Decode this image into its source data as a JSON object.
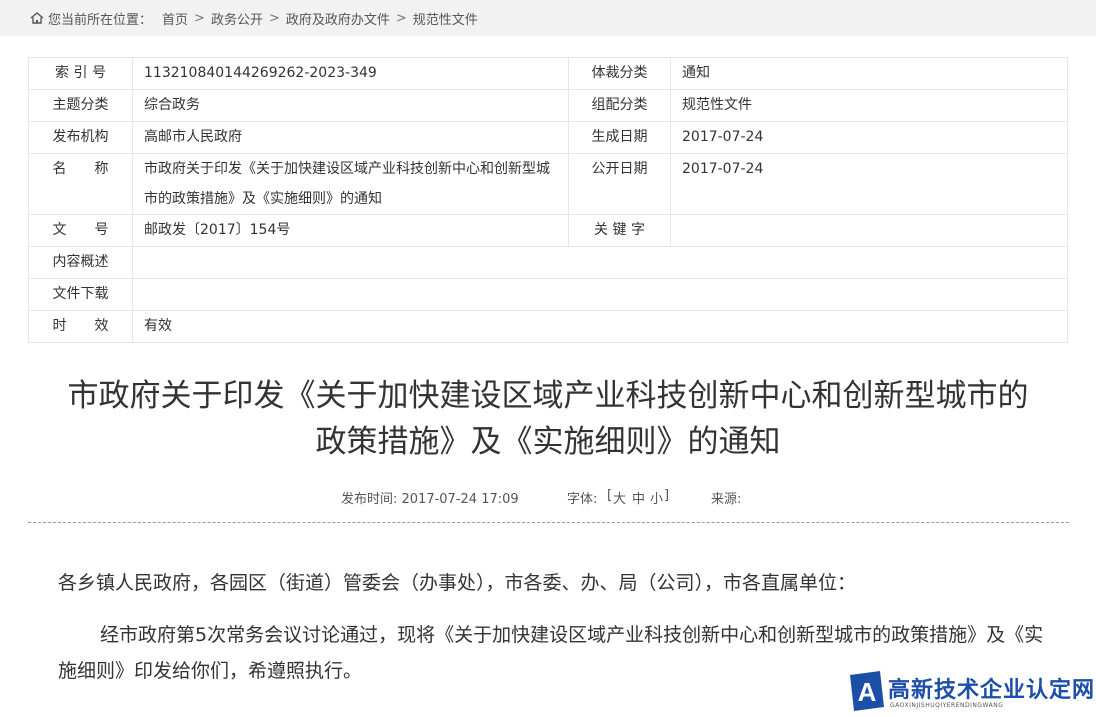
{
  "breadcrumb": {
    "label": "您当前所在位置：",
    "items": [
      "首页",
      "政务公开",
      "政府及政府办文件",
      "规范性文件"
    ],
    "separator": ">"
  },
  "info": {
    "index_label": "索 引 号",
    "index_value": "113210840144269262-2023-349",
    "genre_label": "体裁分类",
    "genre_value": "通知",
    "topic_label": "主题分类",
    "topic_value": "综合政务",
    "category_label": "组配分类",
    "category_value": "规范性文件",
    "publisher_label": "发布机构",
    "publisher_value": "高邮市人民政府",
    "created_label": "生成日期",
    "created_value": "2017-07-24",
    "name_label": "名　　称",
    "name_value": "市政府关于印发《关于加快建设区域产业科技创新中心和创新型城市的政策措施》及《实施细则》的通知",
    "public_label": "公开日期",
    "public_value": "2017-07-24",
    "docno_label": "文　　号",
    "docno_value": "邮政发〔2017〕154号",
    "keyword_label": "关 键 字",
    "keyword_value": "",
    "summary_label": "内容概述",
    "summary_value": "",
    "download_label": "文件下载",
    "download_value": "",
    "validity_label": "时　　效",
    "validity_value": "有效"
  },
  "title": "市政府关于印发《关于加快建设区域产业科技创新中心和创新型城市的政策措施》及《实施细则》的通知",
  "meta": {
    "publish_time": "发布时间: 2017-07-24 17:09",
    "font_label": "字体:",
    "bracket_open": "[",
    "size_large": "大",
    "size_medium": "中",
    "size_small": "小",
    "bracket_close": "]",
    "source_label": "来源:"
  },
  "body": {
    "salutation": "各乡镇人民政府，各园区（街道）管委会（办事处），市各委、办、局（公司），市各直属单位：",
    "paragraph1": "经市政府第5次常务会议讨论通过，现将《关于加快建设区域产业科技创新中心和创新型城市的政策措施》及《实施细则》印发给你们，希遵照执行。"
  },
  "watermark": {
    "title": "高新技术企业认定网",
    "subtitle": "GAOXINJISHUQIYERENDINGWANG",
    "logo_letter": "A",
    "color": "#1b4fa8"
  },
  "colors": {
    "breadcrumb_bg": "#f2f2f2",
    "table_border": "#e6e6e6",
    "text": "#333333"
  }
}
